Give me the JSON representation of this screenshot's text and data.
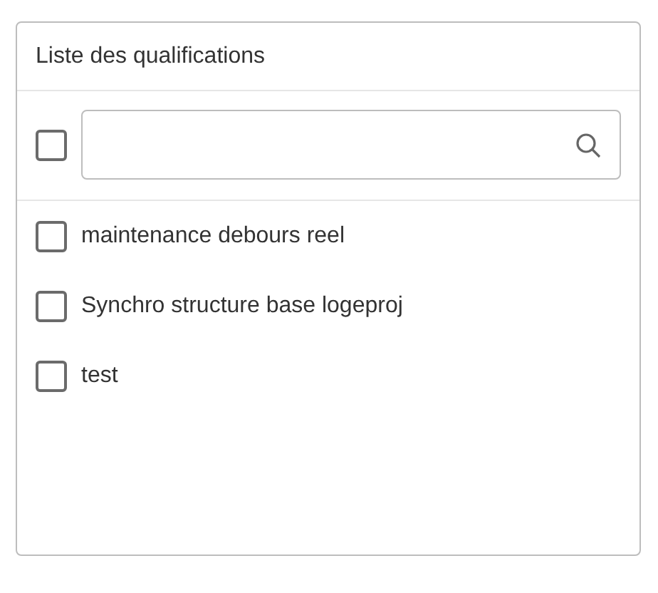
{
  "panel": {
    "title": "Liste des qualifications"
  },
  "search": {
    "select_all_checked": false
  },
  "items": [
    {
      "label": "maintenance debours reel",
      "checked": false
    },
    {
      "label": "Synchro structure base logeproj",
      "checked": false
    },
    {
      "label": "test",
      "checked": false
    }
  ]
}
